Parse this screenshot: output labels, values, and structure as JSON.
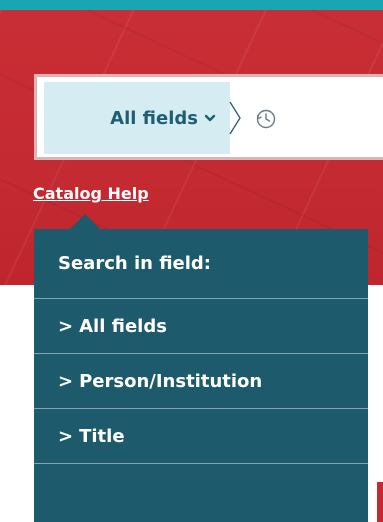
{
  "search": {
    "field_label": "All fields",
    "chevron_icon": "chevron-down-icon",
    "history_icon": "history-clock-icon"
  },
  "help": {
    "label": "Catalog Help"
  },
  "dropdown": {
    "header": "Search in field:",
    "items": [
      {
        "label": "All fields"
      },
      {
        "label": "Person/Institution"
      },
      {
        "label": "Title"
      }
    ],
    "item_prefix": ">"
  },
  "colors": {
    "topbar": "#1aa5b3",
    "hero": "#c42a31",
    "field_bg": "#d6ecf3",
    "field_text": "#1f5e72",
    "dropdown_bg": "#1d5a6b"
  }
}
